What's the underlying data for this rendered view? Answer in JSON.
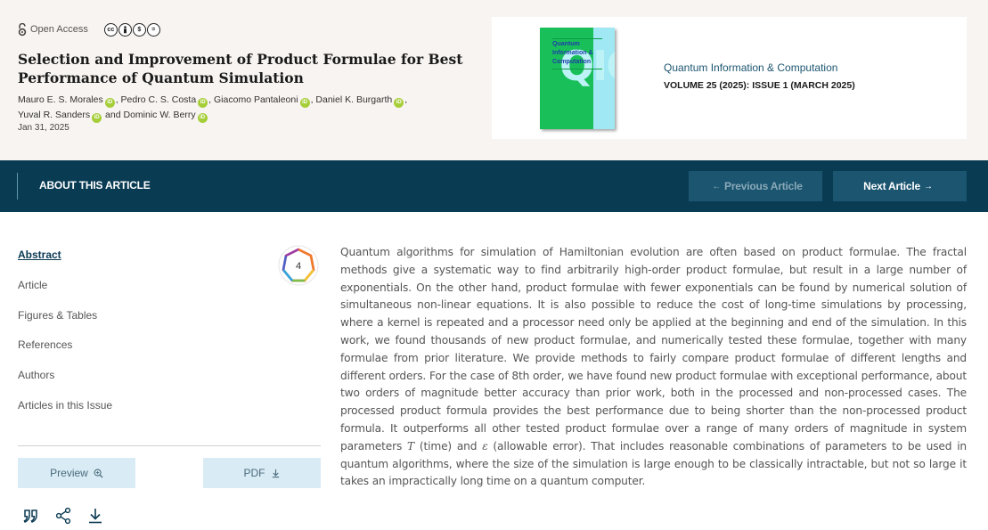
{
  "header": {
    "open_access_label": "Open Access",
    "license_icons": [
      "cc-icon",
      "by-icon",
      "nc-icon",
      "nd-icon"
    ],
    "title": "Selection and Improvement of Product Formulae for Best Performance of Quantum Simulation",
    "authors": [
      {
        "name": "Mauro E. S. Morales",
        "sep": ", "
      },
      {
        "name": "Pedro C. S. Costa",
        "sep": ", "
      },
      {
        "name": "Giacomo Pantaleoni",
        "sep": ", "
      },
      {
        "name": "Daniel K. Burgarth",
        "sep": ","
      },
      {
        "name": "Yuval R. Sanders",
        "sep": " and "
      },
      {
        "name": "Dominic W. Berry",
        "sep": ""
      }
    ],
    "orcid_label": "iD",
    "date": "Jan 31, 2025"
  },
  "journal": {
    "name": "Quantum Information & Computation",
    "issue": "VOLUME 25 (2025): ISSUE 1 (MARCH 2025)",
    "cover_text": "Quantum Information & Computation",
    "cover_letters": "QIC",
    "cover_color": "#19c05a"
  },
  "nav": {
    "title": "ABOUT THIS ARTICLE",
    "prev_label": "Previous Article",
    "next_label": "Next Article"
  },
  "sidebar": {
    "items": [
      {
        "label": "Abstract",
        "active": true
      },
      {
        "label": "Article",
        "active": false
      },
      {
        "label": "Figures & Tables",
        "active": false
      },
      {
        "label": "References",
        "active": false
      },
      {
        "label": "Authors",
        "active": false
      },
      {
        "label": "Articles in this Issue",
        "active": false
      }
    ],
    "metric_badge": "4",
    "preview_label": "Preview",
    "pdf_label": "PDF",
    "tools": [
      "cite-icon",
      "share-icon",
      "download-icon"
    ]
  },
  "abstract": {
    "part1": "Quantum algorithms for simulation of Hamiltonian evolution are often based on product formulae. The fractal methods give a systematic way to find arbitrarily high-order product formulae, but result in a large number of exponentials. On the other hand, product formulae with fewer exponentials can be found by numerical solution of simultaneous non-linear equations. It is also possible to reduce the cost of long-time simulations by processing, where a kernel is repeated and a processor need only be applied at the beginning and end of the simulation. In this work, we found thousands of new product formulae, and numerically tested these formulae, together with many formulae from prior literature. We provide methods to fairly compare product formulae of different lengths and different orders. For the case of 8th order, we have found new product formulae with exceptional performance, about two orders of magnitude better accuracy than prior work, both in the processed and non-processed cases. The processed product formula provides the best performance due to being shorter than the non-processed product formula. It outperforms all other tested product formulae over a range of many orders of magnitude in system parameters ",
    "symbol_t": "T",
    "part2": " (time) and ",
    "symbol_eps": "ε",
    "part3": " (allowable error). That includes reasonable combinations of parameters to be used in quantum algorithms, where the size of the simulation is large enough to be classically intractable, but not so large it takes an impractically long time on a quantum computer."
  },
  "colors": {
    "nav_bg": "#093c53",
    "button_bg": "#1b5570",
    "header_bg": "#f8f4f1",
    "orcid": "#a6ce39"
  }
}
